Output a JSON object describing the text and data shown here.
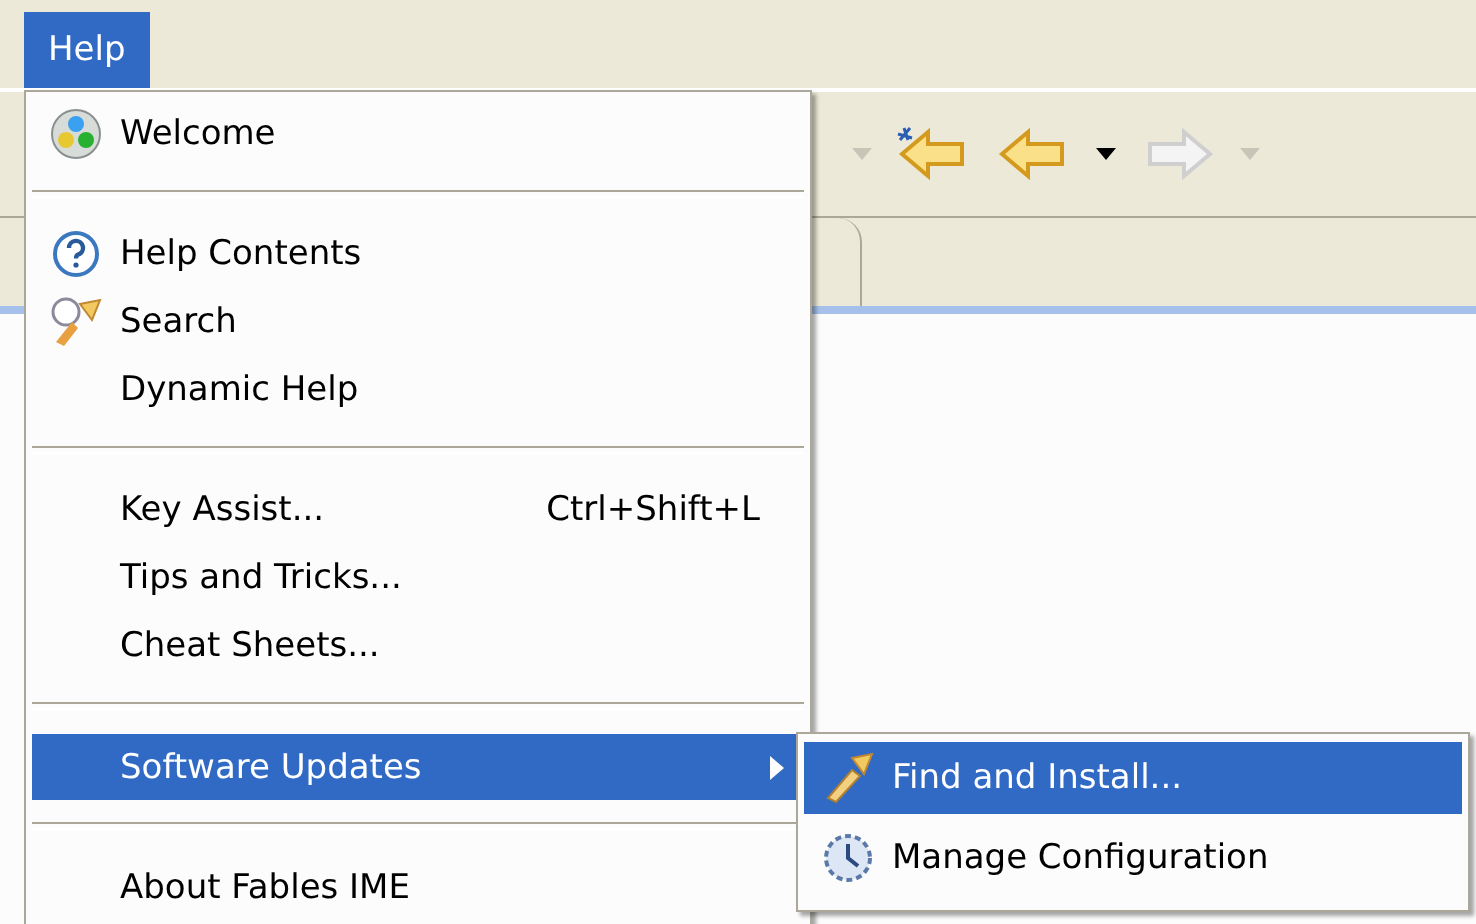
{
  "menu_bar": [
    {
      "label": "Help",
      "selected": true
    }
  ],
  "toolbar": [
    {
      "kind": "caret",
      "disabled": true
    },
    {
      "kind": "new-arrow",
      "disabled": false
    },
    {
      "kind": "back",
      "disabled": false
    },
    {
      "kind": "caret",
      "disabled": false
    },
    {
      "kind": "forward",
      "disabled": true
    },
    {
      "kind": "caret",
      "disabled": true
    }
  ],
  "menu": [
    {
      "kind": "item",
      "label": "Welcome",
      "selected": false
    },
    {
      "kind": "separator"
    },
    {
      "kind": "item",
      "label": "Help Contents",
      "selected": false
    },
    {
      "kind": "item",
      "label": "Search",
      "selected": false
    },
    {
      "kind": "item",
      "label": "Dynamic Help",
      "selected": false
    },
    {
      "kind": "separator"
    },
    {
      "kind": "item",
      "label": "Key Assist...",
      "shortcut": "Ctrl+Shift+L",
      "selected": false
    },
    {
      "kind": "item",
      "label": "Tips and Tricks...",
      "selected": false
    },
    {
      "kind": "item",
      "label": "Cheat Sheets...",
      "selected": false
    },
    {
      "kind": "separator"
    },
    {
      "kind": "submenu",
      "label": "Software Updates",
      "selected": true,
      "children": [
        {
          "label": "Find and Install...",
          "selected": true
        },
        {
          "label": "Manage Configuration",
          "selected": false
        }
      ]
    },
    {
      "kind": "separator"
    },
    {
      "kind": "item",
      "label": "About Fables IME",
      "selected": false
    }
  ]
}
